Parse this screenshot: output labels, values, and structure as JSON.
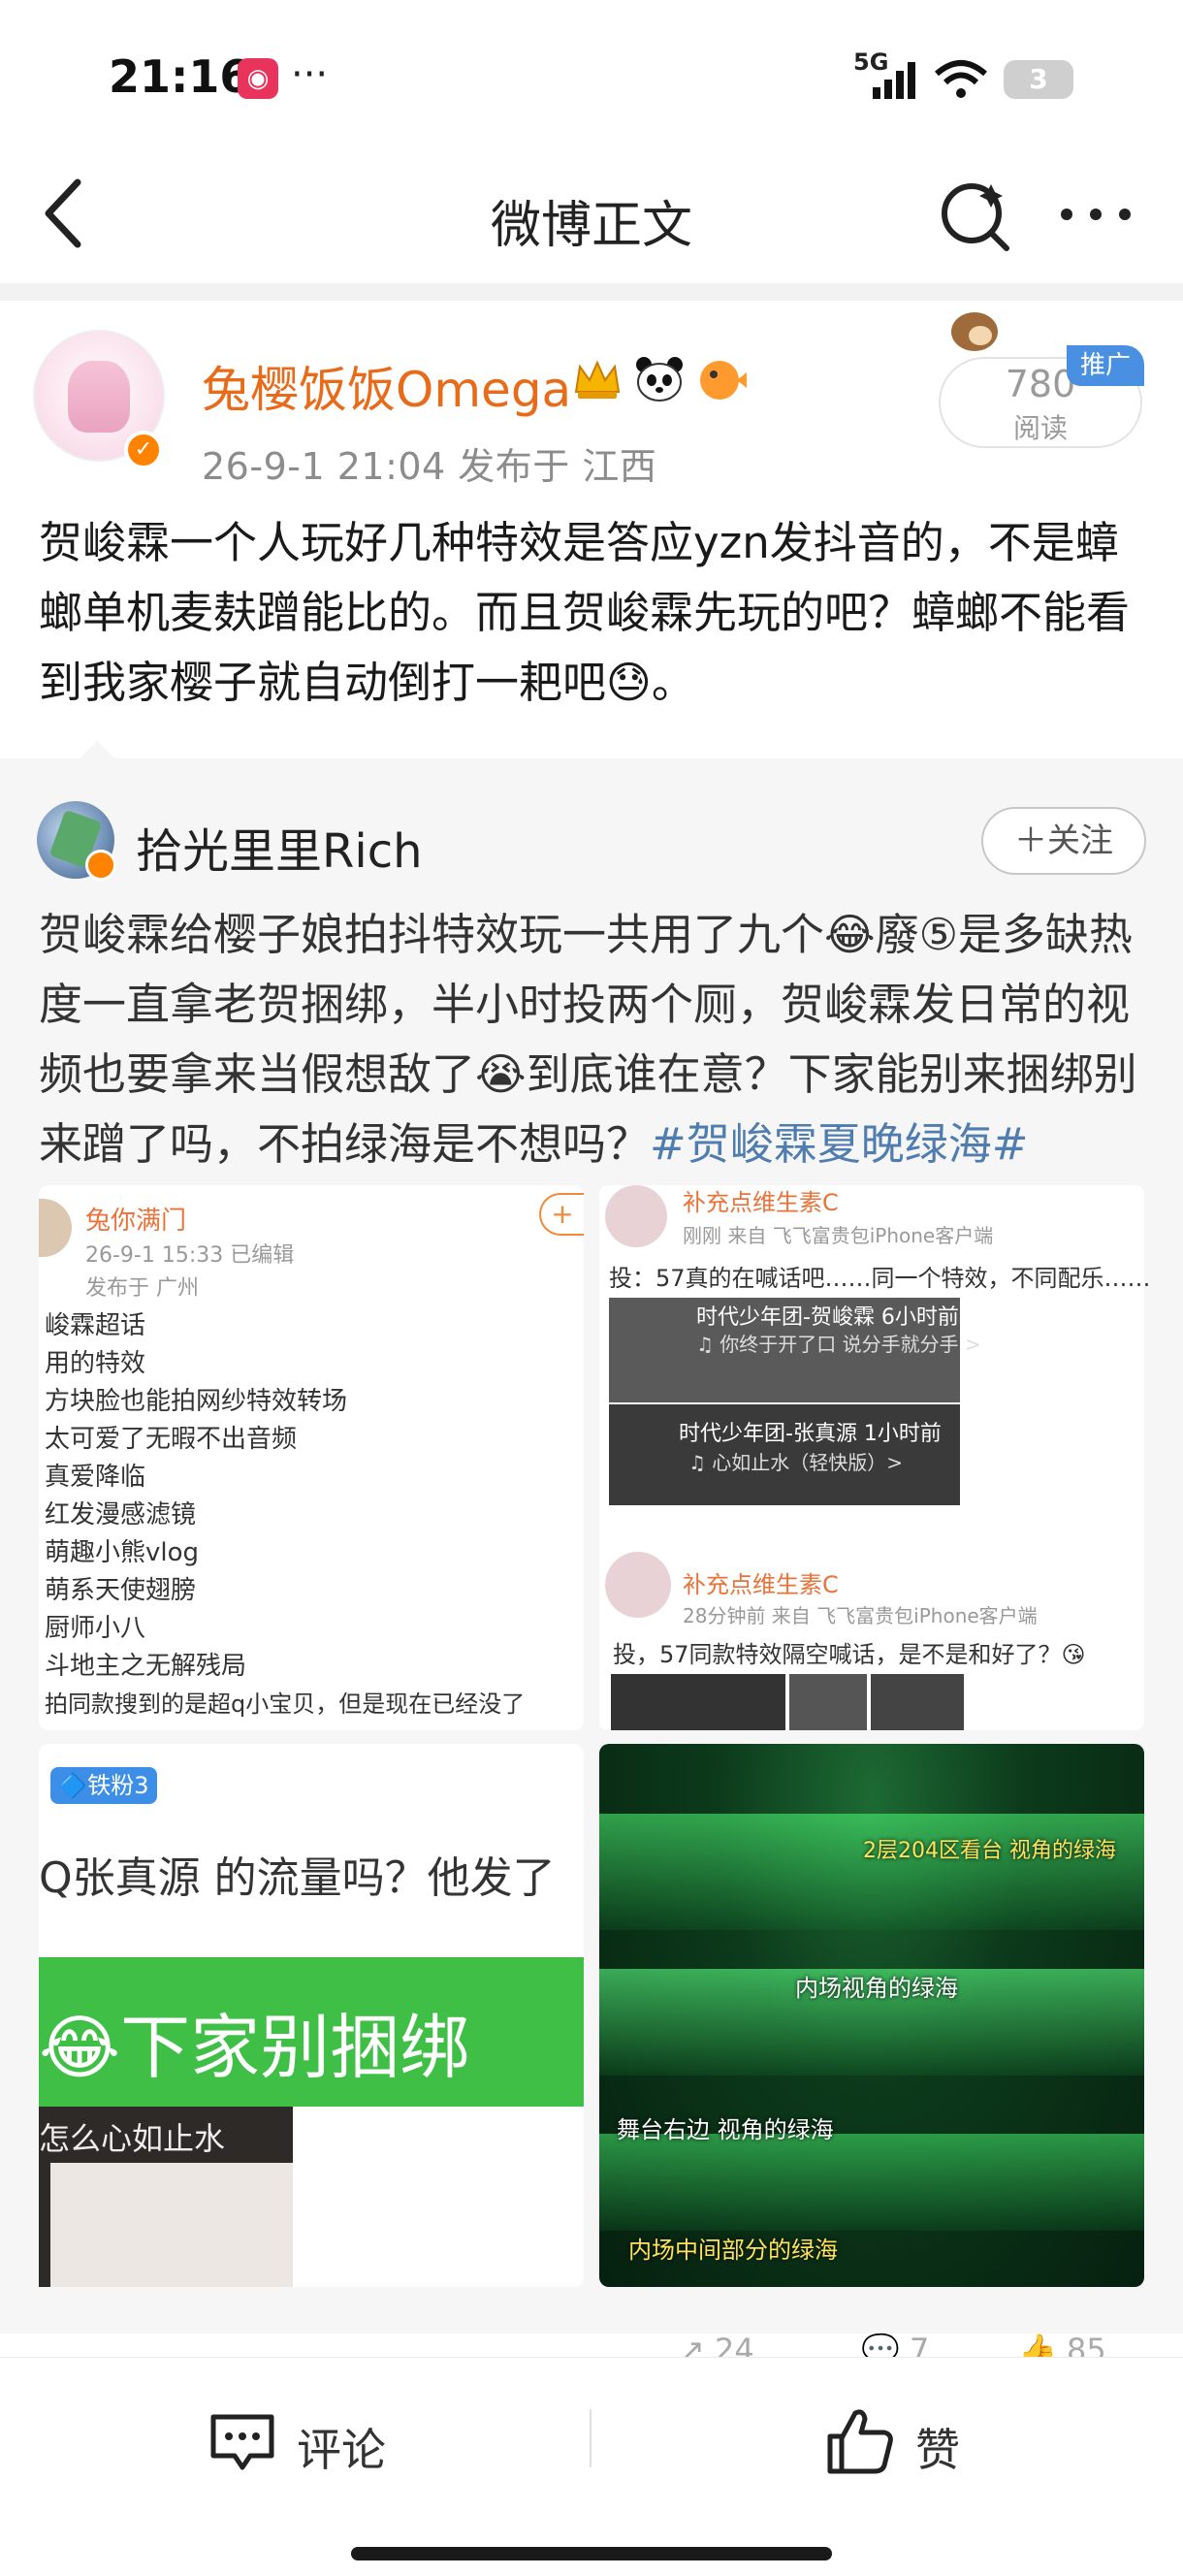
{
  "status_bar": {
    "time": "21:16",
    "network": "5G",
    "battery": "3",
    "more": "···"
  },
  "nav": {
    "title": "微博正文"
  },
  "post": {
    "author": "兔樱饭饭Omega",
    "meta": "26-9-1 21:04  发布于 江西",
    "reads": "780",
    "reads_label": "阅读",
    "promo": "推广",
    "body": "贺峻霖一个人玩好几种特效是答应yzn发抖音的，不是蟑螂单机麦麸蹭能比的。而且贺峻霖先玩的吧？蟑螂不能看到我家樱子就自动倒打一耙吧😓。"
  },
  "repost": {
    "author": "拾光里里Rich",
    "follow_label": "＋关注",
    "body": "贺峻霖给樱子娘拍抖特效玩一共用了九个😂廢⑤是多缺热度一直拿老贺捆绑，半小时投两个厕，贺峻霖发日常的视频也要拿来当假想敌了😭到底谁在意？下家能别来捆绑别来蹭了吗，不拍绿海是不想吗？",
    "hashtag": "#贺峻霖夏晚绿海#"
  },
  "images": {
    "img1": {
      "name": "兔你满门",
      "meta": "26-9-1 15:33  已编辑",
      "meta2": "发布于 广州",
      "list": [
        "峻霖超话",
        "用的特效",
        "方块脸也能拍网纱特效转场",
        "太可爱了无暇不出音频",
        "真爱降临",
        "红发漫感滤镜",
        "萌趣小熊vlog",
        "萌系天使翅膀",
        "厨师小八",
        "斗地主之无解残局",
        "拍同款搜到的是超q小宝贝，但是现在已经没了"
      ],
      "plus": "+"
    },
    "img2": {
      "name": "补充点维生素C",
      "meta": "刚刚  来自 飞飞富贵包iPhone客户端",
      "text": "投：57真的在喊话吧……同一个特效，不同配乐……",
      "vid1_title": "时代少年团-贺峻霖  6小时前",
      "vid1_sub": "♫ 你终于开了口 说分手就分手 >",
      "vid2_title": "时代少年团-张真源  1小时前",
      "vid2_sub": "♫ 心如止水（轻快版）>",
      "name2": "补充点维生素C",
      "meta2": "28分钟前  来自 飞飞富贵包iPhone客户端",
      "text2": "投，57同款特效隔空喊话，是不是和好了？😘"
    },
    "img3": {
      "badge": "🔷铁粉3",
      "line1": "Q张真源 的流量吗？他发了",
      "big": "😂下家别捆绑",
      "small": "怎么心如止水"
    },
    "img4": {
      "l1": "2层204区看台 视角的绿海",
      "l2": "内场视角的绿海",
      "l3": "舞台右边 视角的绿海",
      "l4": "内场中间部分的绿海"
    }
  },
  "actions": {
    "reposts": "24",
    "comments": "7",
    "likes": "85"
  },
  "bottom_bar": {
    "comment_label": "评论",
    "like_label": "赞"
  }
}
